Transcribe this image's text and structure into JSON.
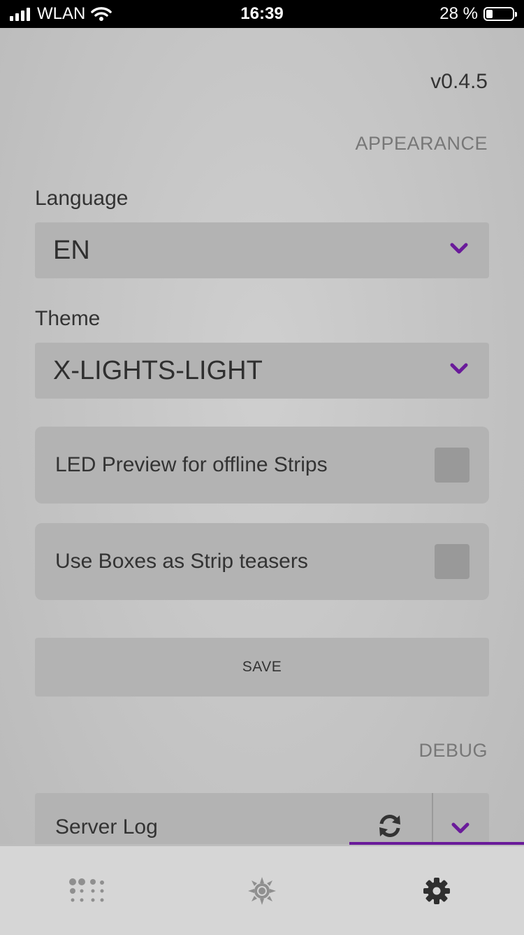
{
  "status_bar": {
    "carrier": "WLAN",
    "time": "16:39",
    "battery_text": "28 %"
  },
  "version": "v0.4.5",
  "appearance": {
    "section_title": "APPEARANCE",
    "language_label": "Language",
    "language_value": "EN",
    "theme_label": "Theme",
    "theme_value": "X-LIGHTS-LIGHT",
    "led_preview_label": "LED Preview for offline Strips",
    "led_preview_checked": false,
    "boxes_label": "Use Boxes as Strip teasers",
    "boxes_checked": false,
    "save_label": "SAVE"
  },
  "debug": {
    "section_title": "DEBUG",
    "server_log_label": "Server Log"
  },
  "tabs": [
    {
      "icon": "led-grid-icon",
      "active": false
    },
    {
      "icon": "sun-icon",
      "active": false
    },
    {
      "icon": "gear-icon",
      "active": true
    }
  ],
  "colors": {
    "accent": "#6a1b9a",
    "card": "#b3b3b3"
  }
}
